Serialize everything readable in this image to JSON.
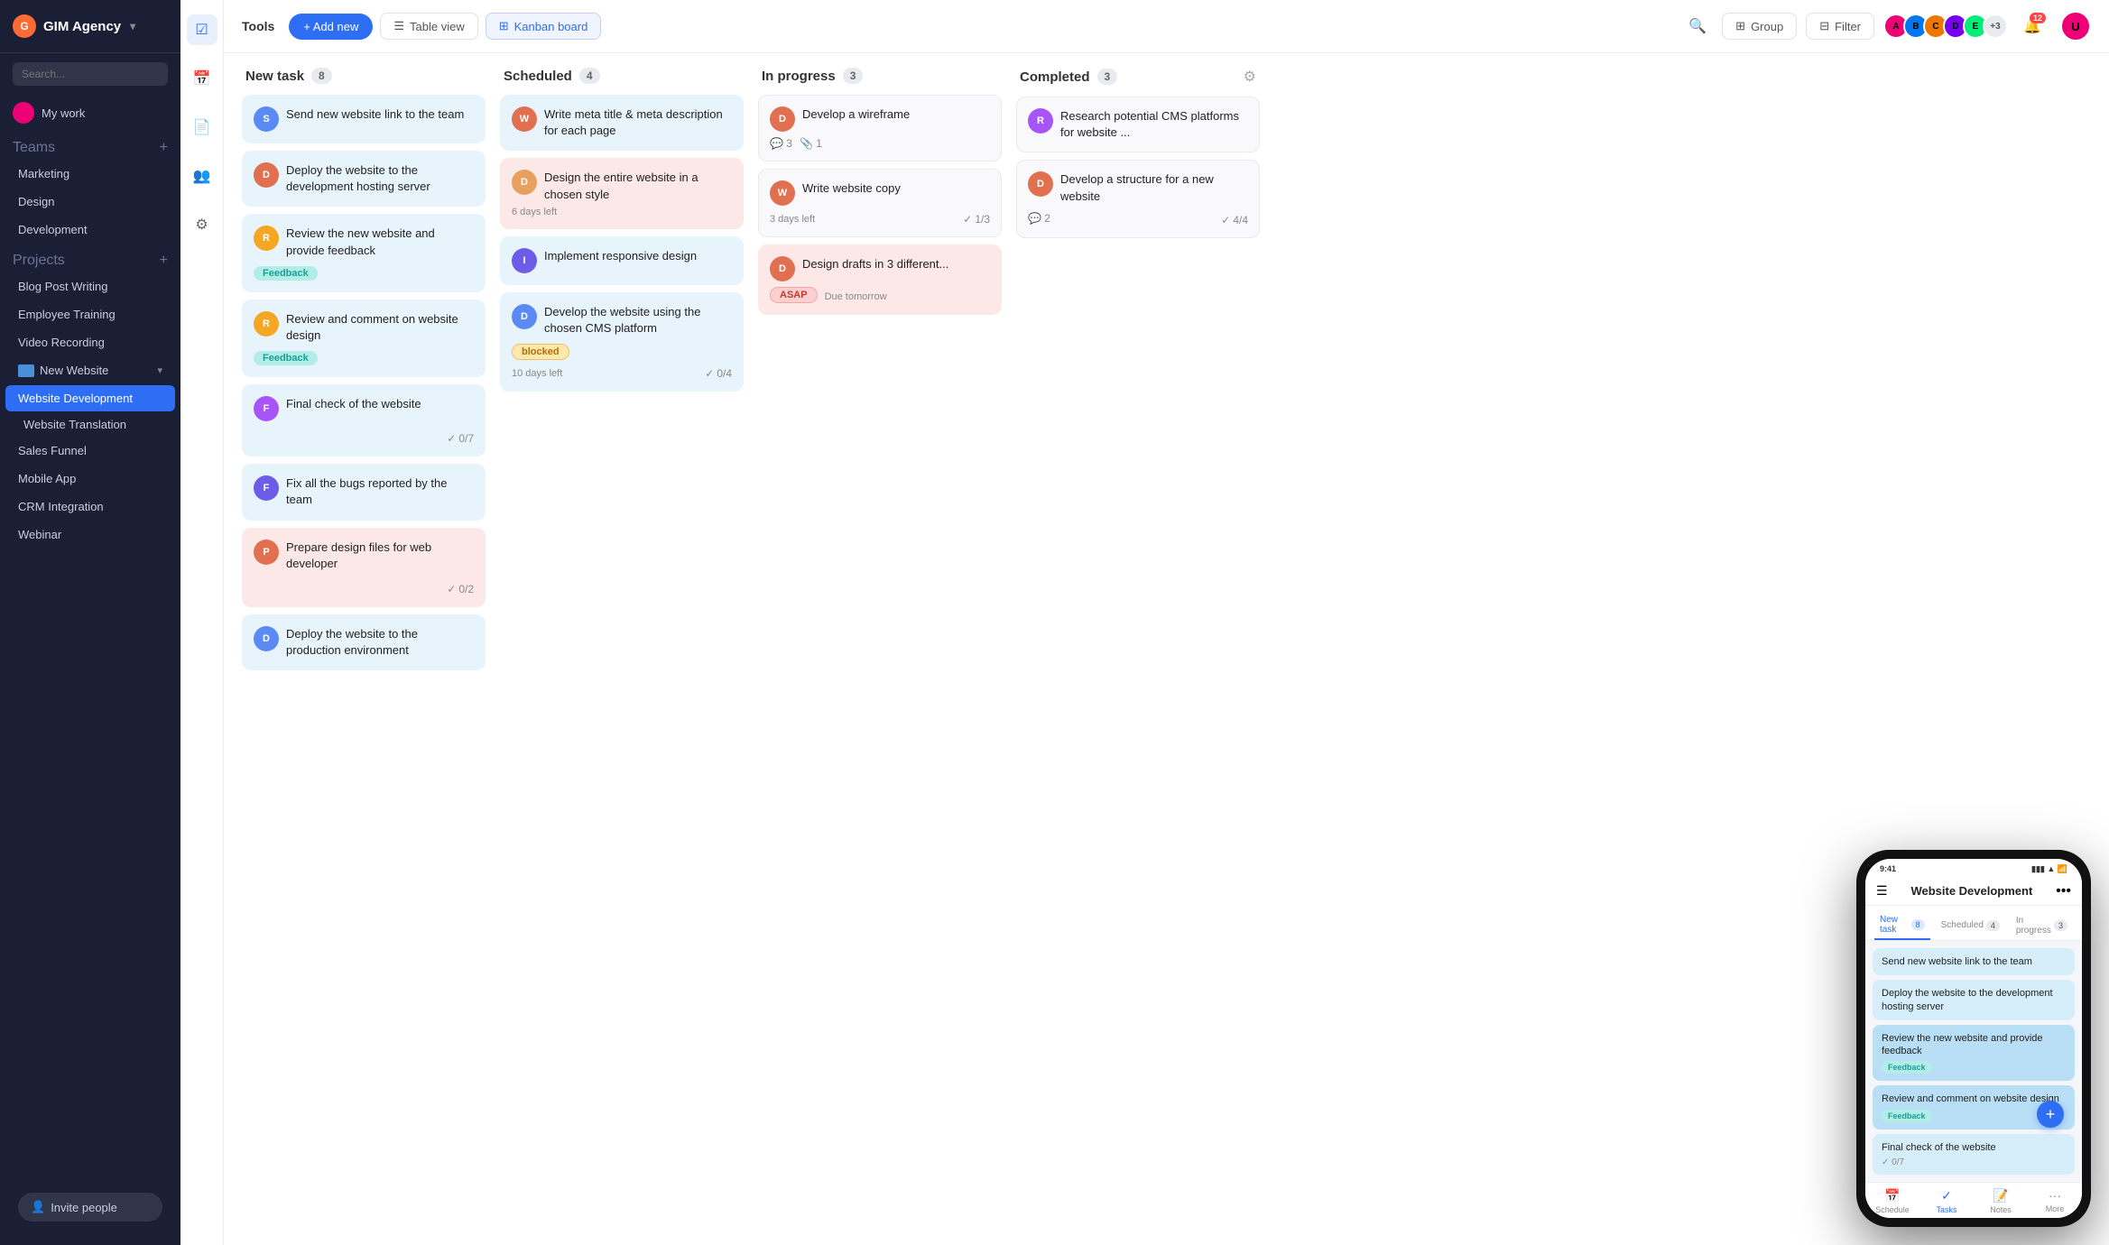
{
  "app": {
    "name": "GIM Agency",
    "logo_letter": "G"
  },
  "sidebar": {
    "search_placeholder": "Search...",
    "my_work": "My work",
    "teams_label": "Teams",
    "teams": [
      {
        "label": "Marketing"
      },
      {
        "label": "Design"
      },
      {
        "label": "Development"
      }
    ],
    "projects_label": "Projects",
    "projects": [
      {
        "label": "Blog Post Writing"
      },
      {
        "label": "Employee Training"
      },
      {
        "label": "Video Recording"
      },
      {
        "label": "New Website",
        "folder": true
      },
      {
        "label": "Website Development",
        "active": true
      },
      {
        "label": "Website Translation"
      },
      {
        "label": "Sales Funnel"
      },
      {
        "label": "Mobile App"
      },
      {
        "label": "CRM Integration"
      },
      {
        "label": "Webinar"
      }
    ],
    "invite_label": "Invite people"
  },
  "toolbar": {
    "title": "Tools",
    "add_new": "+ Add new",
    "table_view": "Table view",
    "kanban_board": "Kanban board",
    "group": "Group",
    "filter": "Filter",
    "avatars_extra": "+3",
    "notif_count": "12"
  },
  "columns": [
    {
      "title": "New task",
      "count": "8",
      "cards": [
        {
          "id": 1,
          "title": "Send new website link to the team",
          "avatar_color": "#5b8af5",
          "avatar_letter": "S",
          "bg": "blue"
        },
        {
          "id": 2,
          "title": "Deploy the website to the development hosting server",
          "avatar_color": "#e07050",
          "avatar_letter": "D",
          "bg": "blue"
        },
        {
          "id": 3,
          "title": "Review the new website and provide feedback",
          "avatar_color": "#f5a623",
          "avatar_letter": "R",
          "bg": "blue",
          "badge": "Feedback",
          "badge_type": "teal"
        },
        {
          "id": 4,
          "title": "Review and comment on website design",
          "avatar_color": "#f5a623",
          "avatar_letter": "R",
          "bg": "blue",
          "badge": "Feedback",
          "badge_type": "teal"
        },
        {
          "id": 5,
          "title": "Final check of the website",
          "avatar_color": "#a855f7",
          "avatar_letter": "F",
          "bg": "blue",
          "check": "0/7"
        },
        {
          "id": 6,
          "title": "Fix all the bugs reported by the team",
          "avatar_color": "#6c5ce7",
          "avatar_letter": "F",
          "bg": "blue"
        },
        {
          "id": 7,
          "title": "Prepare design files for web developer",
          "avatar_color": "#e07050",
          "avatar_letter": "P",
          "bg": "pink",
          "check": "0/2"
        },
        {
          "id": 8,
          "title": "Deploy the website to the production environment",
          "avatar_color": "#5b8af5",
          "avatar_letter": "D",
          "bg": "blue"
        }
      ]
    },
    {
      "title": "Scheduled",
      "count": "4",
      "cards": [
        {
          "id": 9,
          "title": "Write meta title & meta description for each page",
          "avatar_color": "#e07050",
          "avatar_letter": "W",
          "bg": "blue"
        },
        {
          "id": 10,
          "title": "Design the entire website in a chosen style",
          "avatar_color": "#e8a060",
          "avatar_letter": "D",
          "bg": "pink",
          "days_left": "6 days left"
        },
        {
          "id": 11,
          "title": "Implement responsive design",
          "avatar_color": "#6c5ce7",
          "avatar_letter": "I",
          "bg": "blue"
        },
        {
          "id": 12,
          "title": "Develop the website using the chosen CMS platform",
          "avatar_color": "#5b8af5",
          "avatar_letter": "D",
          "bg": "blue",
          "badge": "blocked",
          "badge_type": "blocked",
          "days_left": "10 days left",
          "check": "0/4"
        }
      ]
    },
    {
      "title": "In progress",
      "count": "3",
      "cards": [
        {
          "id": 13,
          "title": "Develop a wireframe",
          "avatar_color": "#e07050",
          "avatar_letter": "D",
          "bg": "white",
          "comments": "3",
          "attachments": "1"
        },
        {
          "id": 14,
          "title": "Write website copy",
          "avatar_color": "#e07050",
          "avatar_letter": "W",
          "bg": "white",
          "days_left": "3 days left",
          "check": "1/3"
        },
        {
          "id": 15,
          "title": "Design drafts in 3 different...",
          "avatar_color": "#e07050",
          "avatar_letter": "D",
          "bg": "pink",
          "badge": "ASAP",
          "badge_type": "red",
          "due": "Due tomorrow"
        }
      ]
    },
    {
      "title": "Completed",
      "count": "3",
      "cards": [
        {
          "id": 16,
          "title": "Research potential CMS platforms for website ...",
          "avatar_color": "#a855f7",
          "avatar_letter": "R",
          "bg": "white"
        },
        {
          "id": 17,
          "title": "Develop a structure for a new website",
          "avatar_color": "#e07050",
          "avatar_letter": "D",
          "bg": "white",
          "comments": "2",
          "check": "4/4"
        }
      ]
    }
  ],
  "phone": {
    "time": "9:41",
    "title": "Website Development",
    "tabs": [
      {
        "label": "New task",
        "count": "8"
      },
      {
        "label": "Scheduled",
        "count": "4"
      },
      {
        "label": "In progress",
        "count": "3"
      }
    ],
    "cards": [
      {
        "title": "Send new website link to the team",
        "color": "#5b8af5"
      },
      {
        "title": "Deploy the website to the development hosting server",
        "color": "#e07050"
      },
      {
        "title": "Review the new website and provide feedback",
        "color": "#f5a623",
        "badge": "Feedback"
      },
      {
        "title": "Review and comment on website design",
        "color": "#f5a623",
        "badge": "Feedback"
      },
      {
        "title": "Final check of the website",
        "color": "#a855f7",
        "check": "0/7"
      }
    ],
    "nav": [
      {
        "label": "Schedule",
        "icon": "📅"
      },
      {
        "label": "Tasks",
        "icon": "✓",
        "active": true
      },
      {
        "label": "Notes",
        "icon": "📝"
      },
      {
        "label": "More",
        "icon": "•••"
      }
    ]
  }
}
